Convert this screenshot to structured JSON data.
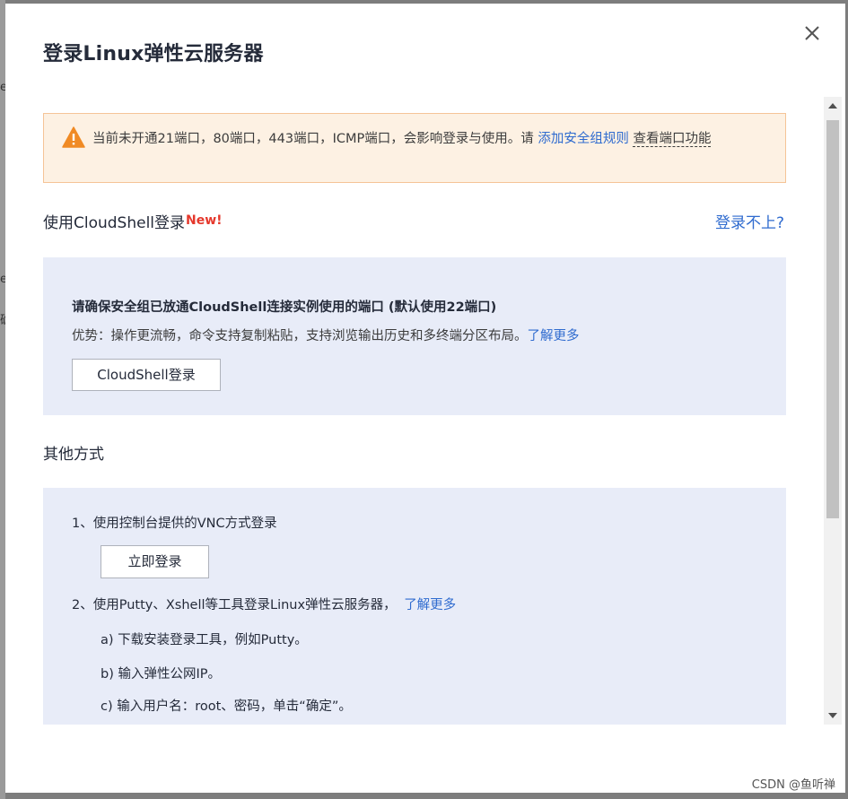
{
  "background": {
    "glyphs": [
      "e",
      "e",
      "确"
    ]
  },
  "dialog": {
    "title": "登录Linux弹性云服务器",
    "close_icon": "close-icon"
  },
  "alert": {
    "icon": "warning-triangle-icon",
    "text": "当前未开通21端口，80端口，443端口，ICMP端口，会影响登录与使用。请",
    "link_add_rule": "添加安全组规则",
    "link_view_ports": "查看端口功能"
  },
  "cloudshell": {
    "title": "使用CloudShell登录",
    "badge": "New!",
    "help_link": "登录不上?",
    "notice": "请确保安全组已放通CloudShell连接实例使用的端口 (默认使用22端口)",
    "advantage": "优势：操作更流畅，命令支持复制粘贴，支持浏览输出历史和多终端分区布局。",
    "learn_more": "了解更多",
    "button_label": "CloudShell登录"
  },
  "other": {
    "title": "其他方式",
    "step1": "1、使用控制台提供的VNC方式登录",
    "login_now": "立即登录",
    "step2": "2、使用Putty、Xshell等工具登录Linux弹性云服务器，",
    "step2_link": "了解更多",
    "substep_a": "a) 下载安装登录工具，例如Putty。",
    "substep_b": "b) 输入弹性公网IP。",
    "substep_c": "c) 输入用户名：root、密码，单击“确定”。"
  },
  "watermark": "CSDN @鱼听禅",
  "colors": {
    "accent_link": "#2f6bcf",
    "warning": "#f08a24",
    "panel_bg": "#e8ecf8",
    "alert_bg": "#fdf1e3",
    "new_badge": "#e5382c"
  }
}
